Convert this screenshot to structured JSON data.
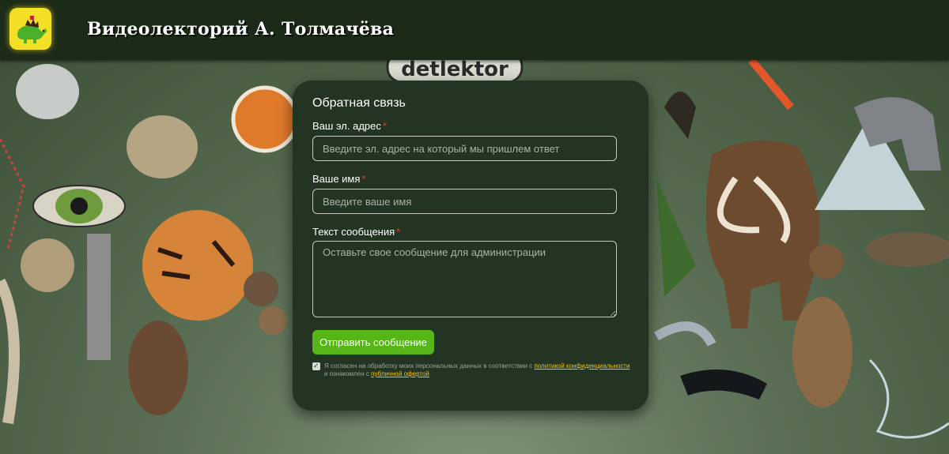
{
  "header": {
    "logo": "dino-logo-icon",
    "site_title": "Видеолекторий А. Толмачёва"
  },
  "background": {
    "sign_text": "detlektor"
  },
  "form": {
    "title": "Обратная связь",
    "email": {
      "label": "Ваш эл. адрес",
      "required_mark": "*",
      "placeholder": "Введите эл. адрес на который мы пришлем ответ",
      "value": ""
    },
    "name": {
      "label": "Ваше имя",
      "required_mark": "*",
      "placeholder": "Введите ваше имя",
      "value": ""
    },
    "message": {
      "label": "Текст сообщения",
      "required_mark": "*",
      "placeholder": "Оставьте свое сообщение для администрации",
      "value": ""
    },
    "submit_label": "Отправить сообщение",
    "consent": {
      "checked": true,
      "text_1": "Я согласен на обработку моих персональных данных в соответствии с",
      "privacy_link": "политикой конфиденциальности",
      "text_2": "и ознакомлен с",
      "offer_link": "публичной офертой"
    }
  },
  "colors": {
    "header_bg": "#1c2a18",
    "card_bg": "#243422",
    "accent_green": "#56b517",
    "link_yellow": "#f2c21a",
    "required_red": "#e53935",
    "logo_yellow": "#f3df25"
  }
}
